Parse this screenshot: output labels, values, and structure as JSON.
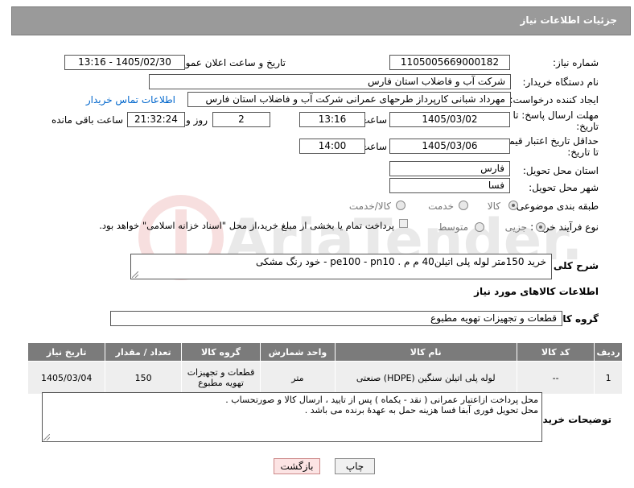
{
  "header": {
    "title": "جزئیات اطلاعات نیاز"
  },
  "form": {
    "need_number_label": "شماره نیاز:",
    "need_number": "1105005669000182",
    "announce_label": "تاریخ و ساعت اعلان عمومی:",
    "announce_value": "1405/02/30 - 13:16",
    "buyer_org_label": "نام دستگاه خریدار:",
    "buyer_org": "شرکت آب و فاضلاب استان فارس",
    "creator_label": "ایجاد کننده درخواست:",
    "creator": "مهرداد شبانی کارپرداز طرحهای عمرانی  شرکت آب و فاضلاب استان فارس",
    "contact_link": "اطلاعات تماس خریدار",
    "deadline_label_1": "مهلت ارسال پاسخ: تا",
    "deadline_label_2": "تاریخ:",
    "deadline_date": "1405/03/02",
    "time_label": "ساعت",
    "deadline_time": "13:16",
    "days_value": "2",
    "days_label": "روز و",
    "remaining_time": "21:32:24",
    "remaining_label": "ساعت باقی مانده",
    "validity_label_1": "حداقل تاریخ اعتبار قیمت:",
    "validity_label_2": "تا تاریخ:",
    "validity_date": "1405/03/06",
    "validity_time": "14:00",
    "province_label": "استان محل تحویل:",
    "province": "فارس",
    "city_label": "شهر محل تحویل:",
    "city": "فسا",
    "category_label": "طبقه بندی موضوعی:",
    "category_options": [
      "کالا",
      "خدمت",
      "کالا/خدمت"
    ],
    "process_label": "نوع فرآیند خرید :",
    "process_options": [
      "جزیی",
      "متوسط"
    ],
    "payment_note": "پرداخت تمام یا بخشی از مبلغ خرید،از محل \"اسناد خزانه اسلامی\" خواهد بود.",
    "description_label": "شرح کلی نیاز:",
    "description": "خرید 150متر  لوله پلی اتیلن40 م م . pe100 - pn10 - خود رنگ مشکی"
  },
  "goods": {
    "section_title": "اطلاعات کالاهای مورد نیاز",
    "group_label": "گروه کالا:",
    "group_value": "قطعات و تجهیزات تهویه مطبوع",
    "columns": [
      "ردیف",
      "کد کالا",
      "نام کالا",
      "واحد شمارش",
      "گروه کالا",
      "تعداد / مقدار",
      "تاریخ نیاز"
    ],
    "rows": [
      {
        "row": "1",
        "code": "--",
        "name": "لوله پلی اتیلن سنگین (HDPE) صنعتی",
        "unit": "متر",
        "group": "قطعات و تجهیزات تهویه مطبوع",
        "qty": "150",
        "date": "1405/03/04"
      }
    ]
  },
  "buyer_notes": {
    "label": "توضیحات خریدار:",
    "line1": "محل پرداخت ازاعتبار عمرانی ( نقد - یکماه )  پس از تایید ، ارسال کالا و صورتحساب .",
    "line2": "محل تحویل فوری آبفا فسا  هزینه حمل  به عهدهٔ برنده می باشد ."
  },
  "buttons": {
    "print": "چاپ",
    "back": "بازگشت"
  },
  "watermark": "AriaTender.neT",
  "colors": {
    "header_bg": "#9a9a9a",
    "table_header_bg": "#7b7b7b",
    "link": "#0066cc",
    "back_button_bg": "#fce4e4"
  }
}
